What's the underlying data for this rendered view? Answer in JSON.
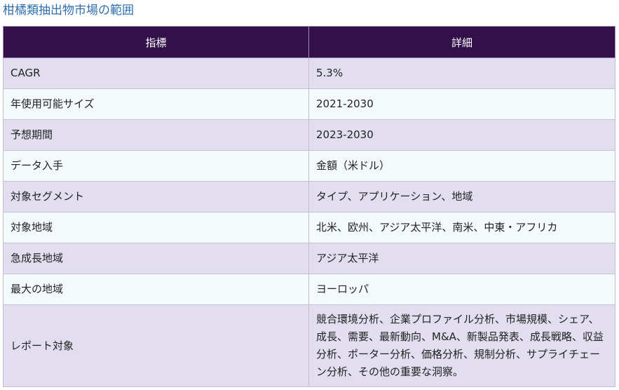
{
  "title": "柑橘類抽出物市場の範囲",
  "table": {
    "headers": [
      "指標",
      "詳細"
    ],
    "rows": [
      {
        "metric": "CAGR",
        "detail": "5.3%"
      },
      {
        "metric": "年使用可能サイズ",
        "detail": "2021-2030"
      },
      {
        "metric": "予想期間",
        "detail": "2023-2030"
      },
      {
        "metric": "データ入手",
        "detail": "金額（米ドル）"
      },
      {
        "metric": "対象セグメント",
        "detail": "タイプ、アプリケーション、地域"
      },
      {
        "metric": "対象地域",
        "detail": "北米、欧州、アジア太平洋、南米、中東・アフリカ"
      },
      {
        "metric": "急成長地域",
        "detail": "アジア太平洋"
      },
      {
        "metric": "最大の地域",
        "detail": "ヨーロッパ"
      },
      {
        "metric": "レポート対象",
        "detail": "競合環境分析、企業プロファイル分析、市場規模、シェア、成長、需要、最新動向、M&A、新製品発表、成長戦略、収益分析、ポーター分析、価格分析、規制分析、サプライチェーン分析、その他の重要な洞察。"
      }
    ]
  }
}
